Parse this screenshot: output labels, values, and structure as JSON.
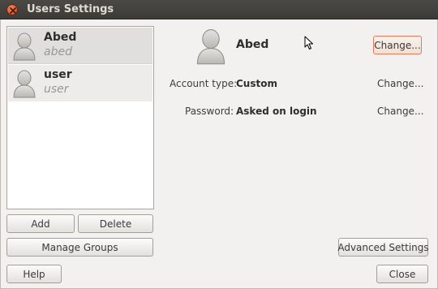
{
  "window": {
    "title": "Users Settings"
  },
  "users": [
    {
      "name": "Abed",
      "login": "abed"
    },
    {
      "name": "user",
      "login": "user"
    }
  ],
  "list_buttons": {
    "add": "Add",
    "delete": "Delete",
    "manage_groups": "Manage Groups"
  },
  "details": {
    "name": "Abed",
    "change_avatar_label": "Change...",
    "account_type_label": "Account type:",
    "account_type_value": "Custom",
    "account_type_change": "Change...",
    "password_label": "Password:",
    "password_value": "Asked on login",
    "password_change": "Change..."
  },
  "footer": {
    "advanced": "Advanced Settings",
    "help": "Help",
    "close": "Close"
  },
  "colors": {
    "titlebar": "#3c3b37",
    "close_button": "#d8532a",
    "focus_border": "#e07a5a"
  },
  "icons": {
    "close": "close-icon",
    "avatar": "user-avatar-icon",
    "cursor": "mouse-pointer-icon"
  }
}
